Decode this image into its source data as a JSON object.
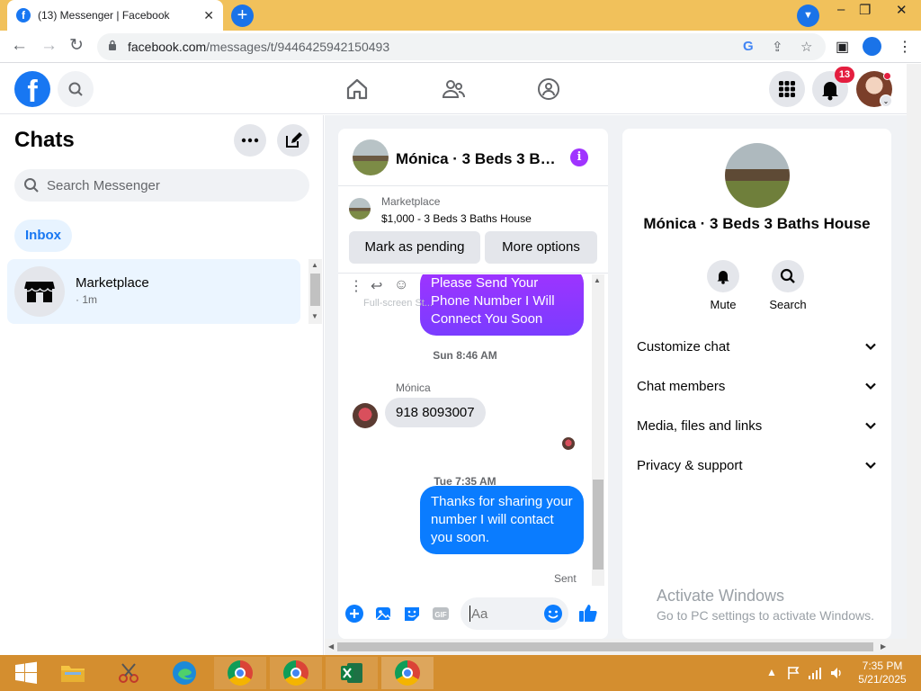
{
  "browser": {
    "tab_title": "(13) Messenger | Facebook",
    "url_host": "facebook.com",
    "url_path": "/messages/t/9446425942150493",
    "window_minimize": "–",
    "window_restore": "❐",
    "window_close": "✕"
  },
  "header": {
    "notification_count": "13"
  },
  "sidebar": {
    "title": "Chats",
    "search_placeholder": "Search Messenger",
    "inbox_label": "Inbox",
    "chats": [
      {
        "name": "Marketplace",
        "time": "· 1m"
      }
    ]
  },
  "conversation": {
    "title": "Mónica · 3 Beds 3 Baths House",
    "marketplace_label": "Marketplace",
    "listing": "$1,000 - 3 Beds 3 Baths House",
    "mark_pending_label": "Mark as pending",
    "more_options_label": "More options",
    "fullscreen_hint": "Full-screen St...",
    "messages": [
      {
        "type": "outgoing",
        "text": "Please Send Your Phone Number I Will Connect You Soon"
      },
      {
        "type": "timestamp",
        "text": "Sun 8:46 AM"
      },
      {
        "type": "incoming",
        "sender": "Mónica",
        "text": "918 8093007"
      },
      {
        "type": "timestamp",
        "text": "Tue 7:35 AM"
      },
      {
        "type": "outgoing",
        "text": "Thanks for sharing your number I will contact you soon."
      }
    ],
    "status": "Sent",
    "input_placeholder": "Aa"
  },
  "info_panel": {
    "name": "Mónica · 3 Beds 3 Baths House",
    "mute_label": "Mute",
    "search_label": "Search",
    "sections": [
      "Customize chat",
      "Chat members",
      "Media, files and links",
      "Privacy & support"
    ]
  },
  "watermark": {
    "line1": "Activate Windows",
    "line2": "Go to PC settings to activate Windows."
  },
  "taskbar": {
    "time": "7:35 PM",
    "date": "5/21/2025"
  },
  "colors": {
    "fb_blue": "#1877f2",
    "messenger_purple": "#a033ff",
    "bubble_blue": "#0a7cff",
    "tab_bar": "#f1c15b",
    "taskbar": "#d48e2f"
  }
}
